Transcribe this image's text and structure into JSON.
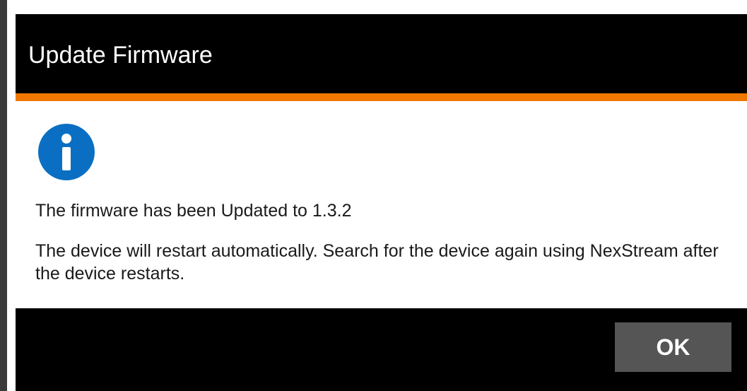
{
  "dialog": {
    "title": "Update Firmware",
    "icon": "info-icon",
    "accent_color": "#f07800",
    "icon_color": "#0a6fc2",
    "message_line_1": "The firmware has been Updated to 1.3.2",
    "message_line_2": "The device will restart automatically. Search for the device again using NexStream after the device restarts.",
    "ok_label": "OK"
  }
}
